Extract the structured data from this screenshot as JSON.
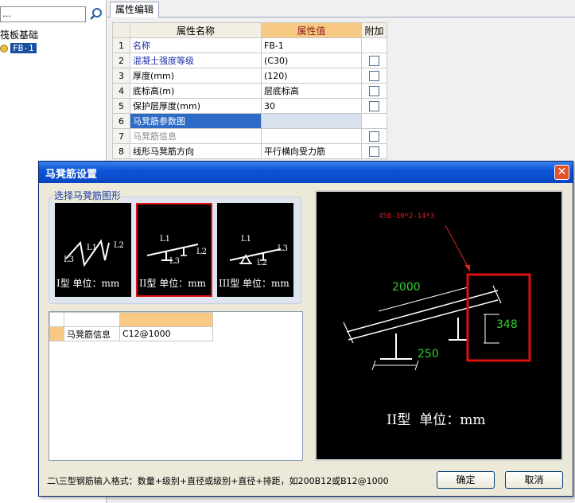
{
  "tree": {
    "search_text": "…",
    "root_label": "筏板基础",
    "selected_item": "FB-1"
  },
  "properties": {
    "tab_label": "属性编辑",
    "headers": {
      "name": "属性名称",
      "value": "属性值",
      "extra": "附加"
    },
    "rows": [
      {
        "num": "1",
        "name": "名称",
        "value": "FB-1",
        "style": "blue",
        "checkbox": false
      },
      {
        "num": "2",
        "name": "混凝土强度等级",
        "value": "(C30)",
        "style": "blue",
        "checkbox": true
      },
      {
        "num": "3",
        "name": "厚度(mm)",
        "value": "(120)",
        "style": "",
        "checkbox": true
      },
      {
        "num": "4",
        "name": "底标高(m)",
        "value": "层底标高",
        "style": "",
        "checkbox": true
      },
      {
        "num": "5",
        "name": "保护层厚度(mm)",
        "value": "30",
        "style": "",
        "checkbox": true
      },
      {
        "num": "6",
        "name": "马凳筋参数图",
        "value": "",
        "style": "selected",
        "checkbox": false
      },
      {
        "num": "7",
        "name": "马凳筋信息",
        "value": "",
        "style": "gray",
        "checkbox": true
      },
      {
        "num": "8",
        "name": "线形马凳筋方向",
        "value": "平行横向受力筋",
        "style": "",
        "checkbox": true
      }
    ]
  },
  "dialog": {
    "title": "马凳筋设置",
    "close_symbol": "✕",
    "shape_group_label": "选择马凳筋图形",
    "shapes": [
      {
        "caption": "I型 单位：mm",
        "labels": [
          "L1",
          "L2",
          "L3"
        ],
        "selected": false
      },
      {
        "caption": "II型 单位：mm",
        "labels": [
          "L1",
          "L2",
          "L3"
        ],
        "selected": true
      },
      {
        "caption": "III型 单位：mm",
        "labels": [
          "L1",
          "L2",
          "L3"
        ],
        "selected": false
      }
    ],
    "info_table": {
      "row_label": "马凳筋信息",
      "row_value": "C12@1000"
    },
    "preview": {
      "formula": "450-30*2-14*3",
      "dim_l1": "2000",
      "dim_l2": "348",
      "dim_l3": "250",
      "caption": "II型  单位：mm",
      "colors": {
        "dims": "#2fd02f",
        "formula": "#e02020",
        "highlight": "#e01010"
      }
    },
    "help_text": "二\\三型钢筋输入格式：数量+级别+直径或级别+直径+排距，如200B12或B12@1000",
    "ok_label": "确定",
    "cancel_label": "取消"
  }
}
